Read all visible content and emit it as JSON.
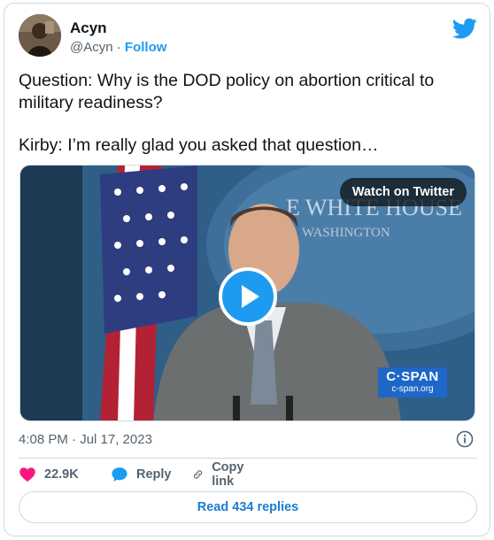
{
  "author": {
    "name": "Acyn",
    "handle": "@Acyn",
    "separator": "·",
    "follow_label": "Follow"
  },
  "tweet": {
    "lines": [
      "Question: Why is the DOD policy on abortion critical to",
      "military readiness?",
      "Kirby: I’m really glad you asked that question…"
    ]
  },
  "media": {
    "watch_label": "Watch on Twitter",
    "backdrop_line1": "E WHITE HOUSE",
    "backdrop_line2": "WASHINGTON",
    "cspan_big": "C·SPAN",
    "cspan_small": "c-span.org"
  },
  "meta": {
    "timestamp": "4:08 PM · Jul 17, 2023"
  },
  "actions": {
    "likes": "22.9K",
    "reply_label": "Reply",
    "copy_label": "Copy link"
  },
  "replies_button": "Read 434 replies",
  "colors": {
    "brand_blue": "#1d9bf0",
    "heart_red": "#f91880",
    "secondary_text": "#536471",
    "border": "#cfd9de"
  },
  "icons": [
    "twitter-bird-icon",
    "play-icon",
    "info-icon",
    "heart-icon",
    "reply-bubble-icon",
    "link-icon"
  ]
}
